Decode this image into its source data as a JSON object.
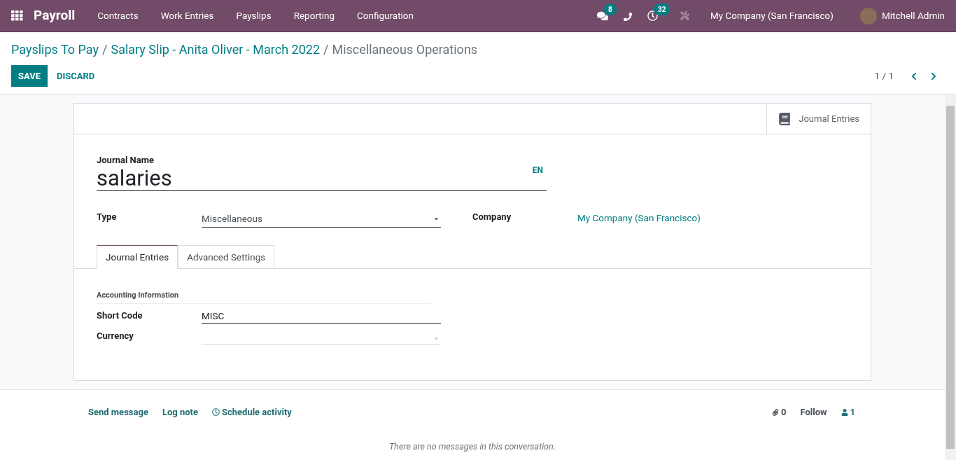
{
  "navbar": {
    "app_name": "Payroll",
    "menu": [
      "Contracts",
      "Work Entries",
      "Payslips",
      "Reporting",
      "Configuration"
    ],
    "messages_badge": "8",
    "activities_badge": "32",
    "company": "My Company (San Francisco)",
    "user": "Mitchell Admin"
  },
  "breadcrumbs": {
    "separator": "/",
    "items": [
      {
        "label": "Payslips To Pay",
        "current": false
      },
      {
        "label": "Salary Slip - Anita Oliver - March 2022",
        "current": false
      },
      {
        "label": "Miscellaneous Operations",
        "current": true
      }
    ]
  },
  "buttons": {
    "save": "SAVE",
    "discard": "DISCARD"
  },
  "pager": "1 / 1",
  "sheet": {
    "smart_button": "Journal Entries",
    "name_label": "Journal Name",
    "name_value": "salaries",
    "lang": "EN",
    "type": {
      "label": "Type",
      "value": "Miscellaneous"
    },
    "company": {
      "label": "Company",
      "value": "My Company (San Francisco)"
    },
    "tabs": [
      {
        "label": "Journal Entries",
        "selected": true
      },
      {
        "label": "Advanced Settings",
        "selected": false
      }
    ],
    "section_title": "Accounting Information",
    "fields": [
      {
        "label": "Short Code",
        "kind": "text",
        "value": "MISC"
      },
      {
        "label": "Currency",
        "kind": "select"
      }
    ]
  },
  "chatter": {
    "actions": [
      "Send message",
      "Log note",
      "Schedule activity"
    ],
    "attachments": "0",
    "follow": "Follow",
    "followers": "1",
    "empty_message": "There are no messages in this conversation."
  }
}
